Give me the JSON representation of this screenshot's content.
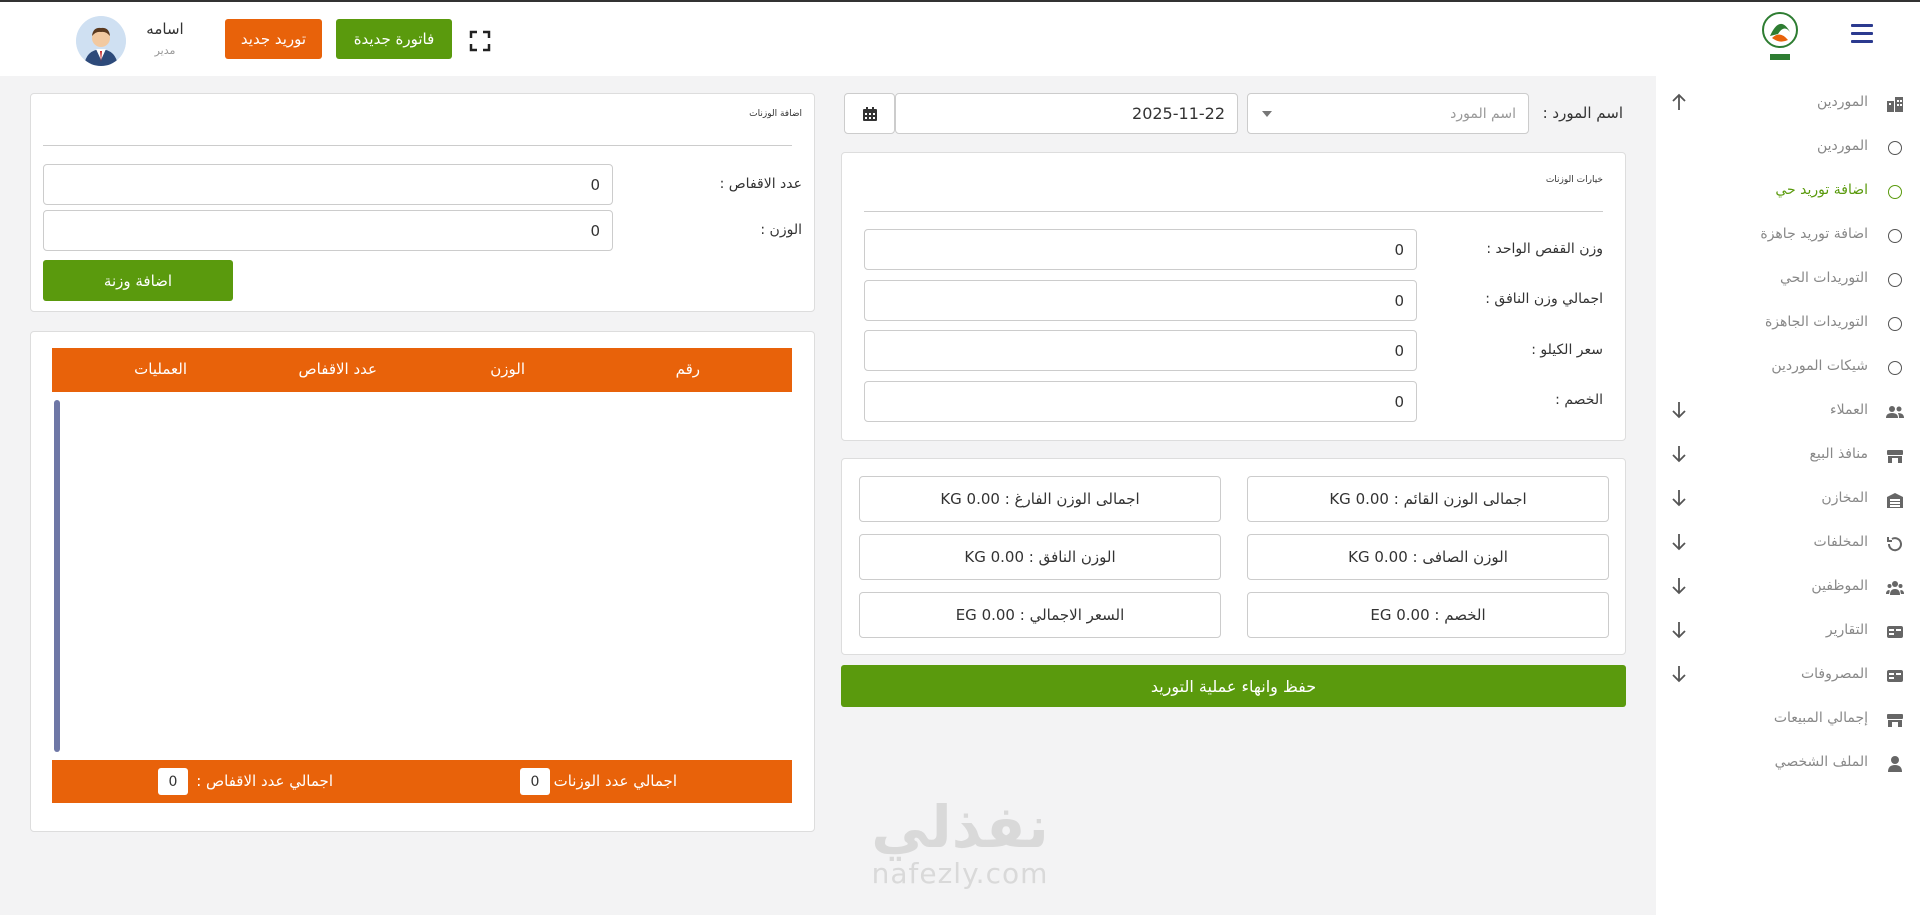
{
  "header": {
    "new_invoice_label": "فاتورة جديدة",
    "new_supply_label": "توريد جديد",
    "user_name": "اسامه",
    "user_role": "مدير"
  },
  "sidebar": {
    "items": [
      {
        "label": "الموردين",
        "icon": "building-icon"
      },
      {
        "label": "الموردين",
        "icon": "circle-icon"
      },
      {
        "label": "اضافة توريد حي",
        "icon": "circle-icon"
      },
      {
        "label": "اضافة توريد جاهزة",
        "icon": "circle-icon"
      },
      {
        "label": "التوريدات الحي",
        "icon": "circle-icon"
      },
      {
        "label": "التوريدات الجاهزة",
        "icon": "circle-icon"
      },
      {
        "label": "شيكات الموردين",
        "icon": "circle-icon"
      },
      {
        "label": "العملاء",
        "icon": "users-icon"
      },
      {
        "label": "منافذ البيع",
        "icon": "store-icon"
      },
      {
        "label": "المخازن",
        "icon": "warehouse-icon"
      },
      {
        "label": "المخلفات",
        "icon": "undo-icon"
      },
      {
        "label": "الموظفين",
        "icon": "employees-icon"
      },
      {
        "label": "التقارير",
        "icon": "report-icon"
      },
      {
        "label": "المصروفات",
        "icon": "expenses-icon"
      },
      {
        "label": "إجمالي المبيعات",
        "icon": "sales-icon"
      },
      {
        "label": "الملف الشخصي",
        "icon": "profile-icon"
      }
    ]
  },
  "supplier": {
    "label": "اسم المورد :",
    "placeholder": "اسم المورد",
    "date": "2025-11-22"
  },
  "weigh_options": {
    "title": "خيارات الوزنات",
    "fields": [
      {
        "label": "وزن القفص الواحد :",
        "value": "0"
      },
      {
        "label": "اجمالي وزن النافق :",
        "value": "0"
      },
      {
        "label": "سعر الكيلو :",
        "value": "0"
      },
      {
        "label": "الخصم :",
        "value": "0"
      }
    ]
  },
  "stats": {
    "total_standing": "اجمالى الوزن القائم : KG 0.00",
    "total_empty": "اجمالى الوزن الفارغ : KG 0.00",
    "net_weight": "الوزن الصافى : KG 0.00",
    "dead_weight": "الوزن النافق : KG 0.00",
    "discount": "الخصم : EG 0.00",
    "total_price": "السعر الاجمالي : EG 0.00"
  },
  "save_label": "حفظ وانهاء عملية التوريد",
  "add_weight": {
    "title": "اضافة الوزنات",
    "cages_label": "عدد الاقفاص :",
    "cages_value": "0",
    "weight_label": "الوزن :",
    "weight_value": "0",
    "button_label": "اضافة وزنة"
  },
  "table": {
    "columns": [
      "رقم",
      "الوزن",
      "عدد الاقفاص",
      "العمليات"
    ],
    "total_weighings_label": "اجمالي عدد الوزنات :",
    "total_weighings": "0",
    "total_cages_label": "اجمالي عدد الاقفاص :",
    "total_cages": "0"
  },
  "watermark": {
    "main": "نفذلي",
    "sub": "nafezly.com"
  },
  "colors": {
    "accent_orange": "#e8620a",
    "accent_green": "#5a9a0d",
    "nav_blue": "#2b3a8f"
  }
}
